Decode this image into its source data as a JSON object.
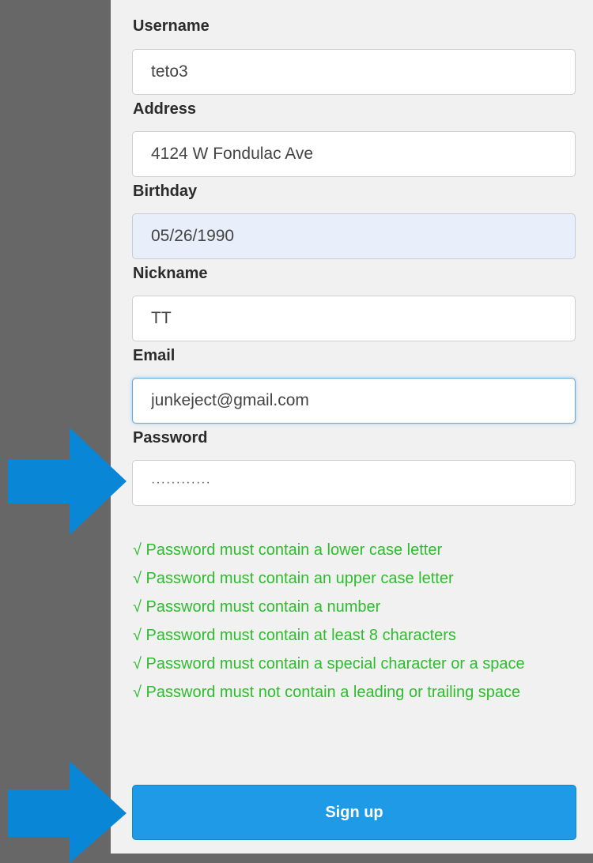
{
  "form": {
    "username": {
      "label": "Username",
      "value": "teto3"
    },
    "address": {
      "label": "Address",
      "value": "4124 W Fondulac Ave"
    },
    "birthday": {
      "label": "Birthday",
      "value": "05/26/1990"
    },
    "nickname": {
      "label": "Nickname",
      "value": "TT"
    },
    "email": {
      "label": "Email",
      "value": "junkeject@gmail.com"
    },
    "password": {
      "label": "Password",
      "value": "············"
    }
  },
  "password_rules": [
    "√ Password must contain a lower case letter",
    "√ Password must contain an upper case letter",
    "√ Password must contain a number",
    "√ Password must contain at least 8 characters",
    "√ Password must contain a special character or a space",
    "√ Password must not contain a leading or trailing space"
  ],
  "signup_button": {
    "label": "Sign up"
  },
  "colors": {
    "rule_ok": "#2dbd2d",
    "button": "#1e9ae7",
    "arrow": "#0a86d6",
    "background": "#676767",
    "panel": "#f1f1f1"
  },
  "icons": {
    "rule_status": "check-mark",
    "annotation": "arrow-right"
  }
}
